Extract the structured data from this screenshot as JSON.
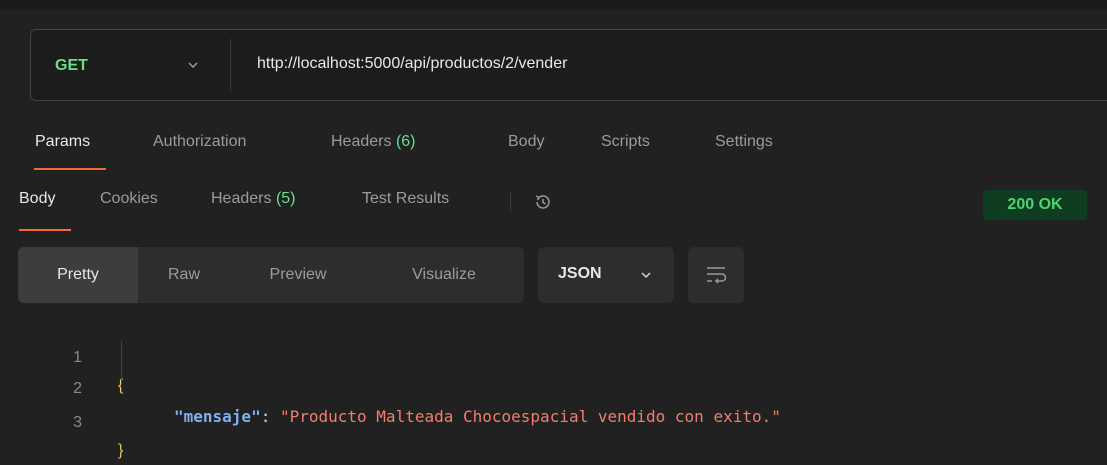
{
  "request": {
    "method": "GET",
    "url": "http://localhost:5000/api/productos/2/vender"
  },
  "request_tabs": [
    {
      "label": "Params",
      "active": true
    },
    {
      "label": "Authorization"
    },
    {
      "label": "Headers",
      "count": "(6)"
    },
    {
      "label": "Body"
    },
    {
      "label": "Scripts"
    },
    {
      "label": "Settings"
    }
  ],
  "response_tabs": [
    {
      "label": "Body",
      "active": true
    },
    {
      "label": "Cookies"
    },
    {
      "label": "Headers",
      "count": "(5)"
    },
    {
      "label": "Test Results"
    }
  ],
  "status": "200 OK",
  "view_options": [
    "Pretty",
    "Raw",
    "Preview",
    "Visualize"
  ],
  "format": "JSON",
  "code": {
    "line_numbers": [
      "1",
      "2",
      "3"
    ],
    "open_brace": "{",
    "close_brace": "}",
    "key": "\"mensaje\"",
    "colon": ": ",
    "value": "\"Producto Malteada Chocoespacial vendido con exito.\""
  },
  "colors": {
    "method": "#6bdd8f",
    "accent": "#f26b3a",
    "status_bg": "#0f3d22",
    "status_text": "#47d66f",
    "json_key": "#7fb0f0",
    "json_string": "#f27d6e"
  }
}
